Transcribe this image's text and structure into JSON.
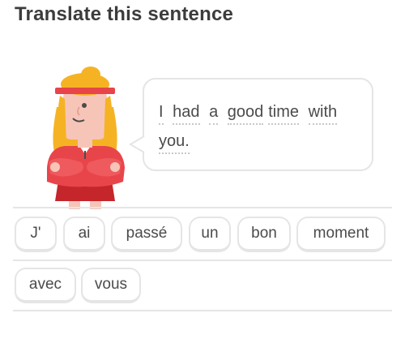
{
  "header": {
    "title": "Translate this sentence"
  },
  "prompt": {
    "line1_words": [
      "I",
      "had",
      "a",
      "good",
      "time",
      "with"
    ],
    "line2_words": [
      "you."
    ]
  },
  "word_bank": {
    "tiles": [
      "J'",
      "ai",
      "passé",
      "un",
      "bon",
      "moment",
      "avec",
      "vous"
    ]
  },
  "colors": {
    "border": "#e5e5e5",
    "text": "#4b4b4b",
    "character_shirt": "#e8454a",
    "character_hair": "#f5b324",
    "character_headband": "#e8454a"
  },
  "icons": {
    "character": "woman-character-illustration"
  }
}
